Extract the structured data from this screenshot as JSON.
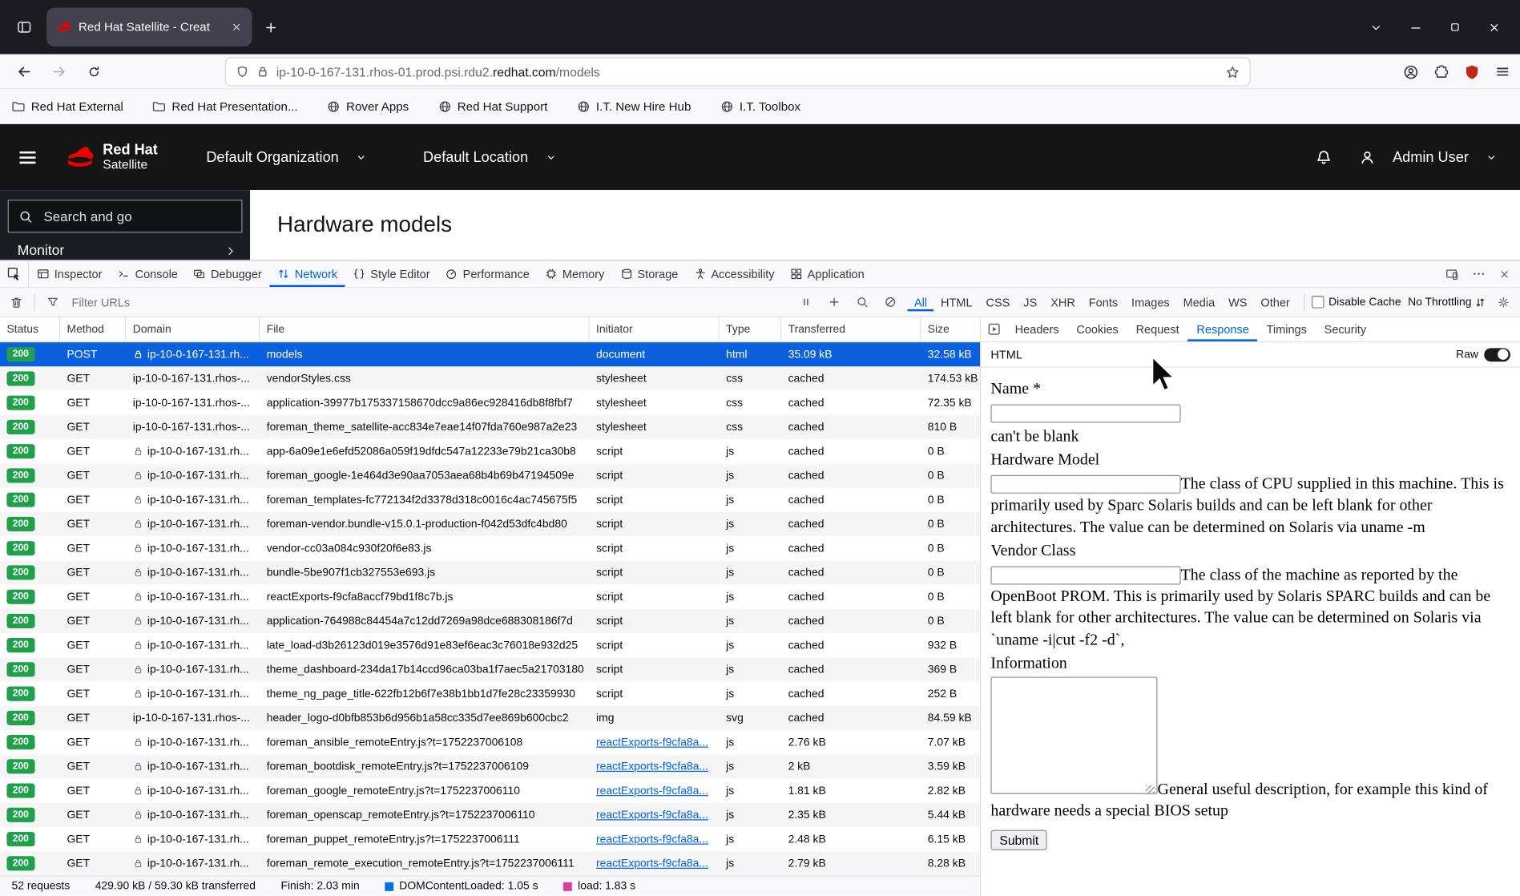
{
  "colors": {
    "accent_blue": "#0060df",
    "selection_blue": "#0a60dd",
    "status_green": "#21a04c",
    "redhat_red": "#ee0000"
  },
  "browser": {
    "tab_title": "Red Hat Satellite - Creat",
    "url_pre": "ip-10-0-167-131.rhos-01.prod.psi.rdu2.",
    "url_domain": "redhat.com",
    "url_path": "/models",
    "bookmarks": [
      {
        "label": "Red Hat External",
        "icon": "folder-icon"
      },
      {
        "label": "Red Hat Presentation...",
        "icon": "folder-icon"
      },
      {
        "label": "Rover Apps",
        "icon": "globe-icon"
      },
      {
        "label": "Red Hat Support",
        "icon": "globe-icon"
      },
      {
        "label": "I.T. New Hire Hub",
        "icon": "globe-icon"
      },
      {
        "label": "I.T. Toolbox",
        "icon": "globe-icon"
      }
    ]
  },
  "satellite": {
    "brand_top": "Red Hat",
    "brand_bottom": "Satellite",
    "organization": "Default Organization",
    "location": "Default Location",
    "user": "Admin User",
    "search_placeholder": "Search and go",
    "sidebar_item": "Monitor",
    "page_title": "Hardware models"
  },
  "devtools": {
    "tabs": [
      {
        "label": "Inspector",
        "icon": "inspector-icon"
      },
      {
        "label": "Console",
        "icon": "console-icon"
      },
      {
        "label": "Debugger",
        "icon": "debugger-icon"
      },
      {
        "label": "Network",
        "icon": "network-icon"
      },
      {
        "label": "Style Editor",
        "icon": "style-editor-icon"
      },
      {
        "label": "Performance",
        "icon": "performance-icon"
      },
      {
        "label": "Memory",
        "icon": "memory-icon"
      },
      {
        "label": "Storage",
        "icon": "storage-icon"
      },
      {
        "label": "Accessibility",
        "icon": "accessibility-icon"
      },
      {
        "label": "Application",
        "icon": "application-icon"
      }
    ],
    "selected_tab": "Network",
    "filter_placeholder": "Filter URLs",
    "filter_pills": [
      "All",
      "HTML",
      "CSS",
      "JS",
      "XHR",
      "Fonts",
      "Images",
      "Media",
      "WS",
      "Other"
    ],
    "selected_pill": "All",
    "disable_cache_label": "Disable Cache",
    "throttling_label": "No Throttling",
    "columns": [
      "Status",
      "Method",
      "Domain",
      "File",
      "Initiator",
      "Type",
      "Transferred",
      "Size"
    ],
    "requests": [
      {
        "status": "200",
        "method": "POST",
        "lock": true,
        "domain": "ip-10-0-167-131.rh...",
        "file": "models",
        "initiator": "document",
        "initiator_link": false,
        "type": "html",
        "transferred": "35.09 kB",
        "size": "32.58 kB",
        "selected": true
      },
      {
        "status": "200",
        "method": "GET",
        "lock": false,
        "domain": "ip-10-0-167-131.rhos-...",
        "file": "vendorStyles.css",
        "initiator": "stylesheet",
        "initiator_link": false,
        "type": "css",
        "transferred": "cached",
        "size": "174.53 kB",
        "selected": false
      },
      {
        "status": "200",
        "method": "GET",
        "lock": false,
        "domain": "ip-10-0-167-131.rhos-...",
        "file": "application-39977b175337158670dcc9a86ec928416db8f8fbf7",
        "initiator": "stylesheet",
        "initiator_link": false,
        "type": "css",
        "transferred": "cached",
        "size": "72.35 kB",
        "selected": false
      },
      {
        "status": "200",
        "method": "GET",
        "lock": false,
        "domain": "ip-10-0-167-131.rhos-...",
        "file": "foreman_theme_satellite-acc834e7eae14f07fda760e987a2e23",
        "initiator": "stylesheet",
        "initiator_link": false,
        "type": "css",
        "transferred": "cached",
        "size": "810 B",
        "selected": false
      },
      {
        "status": "200",
        "method": "GET",
        "lock": true,
        "domain": "ip-10-0-167-131.rh...",
        "file": "app-6a09e1e6efd52086a059f19dfdc547a12233e79b21ca30b8",
        "initiator": "script",
        "initiator_link": false,
        "type": "js",
        "transferred": "cached",
        "size": "0 B",
        "selected": false
      },
      {
        "status": "200",
        "method": "GET",
        "lock": true,
        "domain": "ip-10-0-167-131.rh...",
        "file": "foreman_google-1e464d3e90aa7053aea68b4b69b47194509e",
        "initiator": "script",
        "initiator_link": false,
        "type": "js",
        "transferred": "cached",
        "size": "0 B",
        "selected": false
      },
      {
        "status": "200",
        "method": "GET",
        "lock": true,
        "domain": "ip-10-0-167-131.rh...",
        "file": "foreman_templates-fc772134f2d3378d318c0016c4ac745675f5",
        "initiator": "script",
        "initiator_link": false,
        "type": "js",
        "transferred": "cached",
        "size": "0 B",
        "selected": false
      },
      {
        "status": "200",
        "method": "GET",
        "lock": true,
        "domain": "ip-10-0-167-131.rh...",
        "file": "foreman-vendor.bundle-v15.0.1-production-f042d53dfc4bd80",
        "initiator": "script",
        "initiator_link": false,
        "type": "js",
        "transferred": "cached",
        "size": "0 B",
        "selected": false
      },
      {
        "status": "200",
        "method": "GET",
        "lock": true,
        "domain": "ip-10-0-167-131.rh...",
        "file": "vendor-cc03a084c930f20f6e83.js",
        "initiator": "script",
        "initiator_link": false,
        "type": "js",
        "transferred": "cached",
        "size": "0 B",
        "selected": false
      },
      {
        "status": "200",
        "method": "GET",
        "lock": true,
        "domain": "ip-10-0-167-131.rh...",
        "file": "bundle-5be907f1cb327553e693.js",
        "initiator": "script",
        "initiator_link": false,
        "type": "js",
        "transferred": "cached",
        "size": "0 B",
        "selected": false
      },
      {
        "status": "200",
        "method": "GET",
        "lock": true,
        "domain": "ip-10-0-167-131.rh...",
        "file": "reactExports-f9cfa8accf79bd1f8c7b.js",
        "initiator": "script",
        "initiator_link": false,
        "type": "js",
        "transferred": "cached",
        "size": "0 B",
        "selected": false
      },
      {
        "status": "200",
        "method": "GET",
        "lock": true,
        "domain": "ip-10-0-167-131.rh...",
        "file": "application-764988c84454a7c12dd7269a98dce688308186f7d",
        "initiator": "script",
        "initiator_link": false,
        "type": "js",
        "transferred": "cached",
        "size": "0 B",
        "selected": false
      },
      {
        "status": "200",
        "method": "GET",
        "lock": true,
        "domain": "ip-10-0-167-131.rh...",
        "file": "late_load-d3b26123d019e3576d91e83ef6eac3c76018e932d25",
        "initiator": "script",
        "initiator_link": false,
        "type": "js",
        "transferred": "cached",
        "size": "932 B",
        "selected": false
      },
      {
        "status": "200",
        "method": "GET",
        "lock": true,
        "domain": "ip-10-0-167-131.rh...",
        "file": "theme_dashboard-234da17b14ccd96ca03ba1f7aec5a21703180",
        "initiator": "script",
        "initiator_link": false,
        "type": "js",
        "transferred": "cached",
        "size": "369 B",
        "selected": false
      },
      {
        "status": "200",
        "method": "GET",
        "lock": true,
        "domain": "ip-10-0-167-131.rh...",
        "file": "theme_ng_page_title-622fb12b6f7e38b1bb1d7fe28c23359930",
        "initiator": "script",
        "initiator_link": false,
        "type": "js",
        "transferred": "cached",
        "size": "252 B",
        "selected": false
      },
      {
        "status": "200",
        "method": "GET",
        "lock": false,
        "domain": "ip-10-0-167-131.rhos-...",
        "file": "header_logo-d0bfb853b6d956b1a58cc335d7ee869b600cbc2",
        "initiator": "img",
        "initiator_link": false,
        "type": "svg",
        "transferred": "cached",
        "size": "84.59 kB",
        "selected": false
      },
      {
        "status": "200",
        "method": "GET",
        "lock": true,
        "domain": "ip-10-0-167-131.rh...",
        "file": "foreman_ansible_remoteEntry.js?t=1752237006108",
        "initiator": "reactExports-f9cfa8a...",
        "initiator_link": true,
        "type": "js",
        "transferred": "2.76 kB",
        "size": "7.07 kB",
        "selected": false
      },
      {
        "status": "200",
        "method": "GET",
        "lock": true,
        "domain": "ip-10-0-167-131.rh...",
        "file": "foreman_bootdisk_remoteEntry.js?t=1752237006109",
        "initiator": "reactExports-f9cfa8a...",
        "initiator_link": true,
        "type": "js",
        "transferred": "2 kB",
        "size": "3.59 kB",
        "selected": false
      },
      {
        "status": "200",
        "method": "GET",
        "lock": true,
        "domain": "ip-10-0-167-131.rh...",
        "file": "foreman_google_remoteEntry.js?t=1752237006110",
        "initiator": "reactExports-f9cfa8a...",
        "initiator_link": true,
        "type": "js",
        "transferred": "1.81 kB",
        "size": "2.82 kB",
        "selected": false
      },
      {
        "status": "200",
        "method": "GET",
        "lock": true,
        "domain": "ip-10-0-167-131.rh...",
        "file": "foreman_openscap_remoteEntry.js?t=1752237006110",
        "initiator": "reactExports-f9cfa8a...",
        "initiator_link": true,
        "type": "js",
        "transferred": "2.35 kB",
        "size": "5.44 kB",
        "selected": false
      },
      {
        "status": "200",
        "method": "GET",
        "lock": true,
        "domain": "ip-10-0-167-131.rh...",
        "file": "foreman_puppet_remoteEntry.js?t=1752237006111",
        "initiator": "reactExports-f9cfa8a...",
        "initiator_link": true,
        "type": "js",
        "transferred": "2.48 kB",
        "size": "6.15 kB",
        "selected": false
      },
      {
        "status": "200",
        "method": "GET",
        "lock": true,
        "domain": "ip-10-0-167-131.rh...",
        "file": "foreman_remote_execution_remoteEntry.js?t=1752237006111",
        "initiator": "reactExports-f9cfa8a...",
        "initiator_link": true,
        "type": "js",
        "transferred": "2.79 kB",
        "size": "8.28 kB",
        "selected": false
      }
    ],
    "summary": {
      "requests": "52 requests",
      "transferred": "429.90 kB / 59.30 kB transferred",
      "finish": "Finish: 2.03 min",
      "dcl": "DOMContentLoaded: 1.05 s",
      "dcl_color": "#0074e8",
      "load": "load: 1.83 s",
      "load_color": "#df3b9a"
    },
    "details": {
      "tabs": [
        "Headers",
        "Cookies",
        "Request",
        "Response",
        "Timings",
        "Security"
      ],
      "selected_tab": "Response",
      "content_type": "HTML",
      "raw_label": "Raw"
    }
  },
  "response_preview": {
    "name_label": "Name *",
    "name_error": "can't be blank",
    "hardware_model_label": "Hardware Model",
    "hardware_model_help": "The class of CPU supplied in this machine. This is primarily used by Sparc Solaris builds and can be left blank for other architectures. The value can be determined on Solaris via uname -m",
    "vendor_class_label": "Vendor Class",
    "vendor_class_help": "The class of the machine as reported by the OpenBoot PROM. This is primarily used by Solaris SPARC builds and can be left blank for other architectures. The value can be determined on Solaris via `uname -i|cut -f2 -d`,",
    "information_label": "Information",
    "information_help": "General useful description, for example this kind of hardware needs a special BIOS setup",
    "submit_label": "Submit"
  }
}
